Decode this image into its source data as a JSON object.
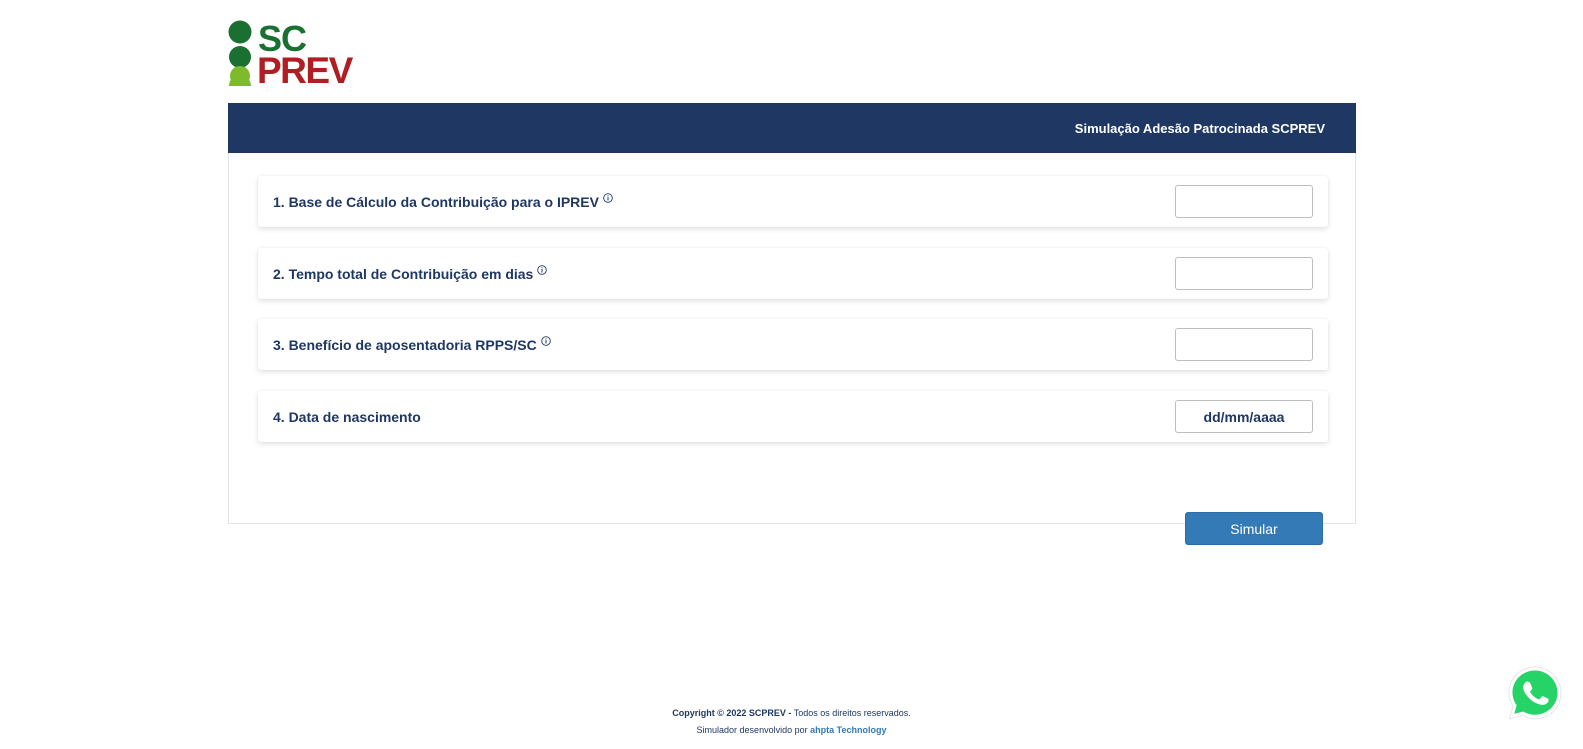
{
  "logo": {
    "text_top": "SC",
    "text_bottom": "PREV",
    "colors": {
      "green_dark": "#1a7030",
      "green_light": "#7dbb2c",
      "red": "#b01e23"
    }
  },
  "header": {
    "title": "Simulação Adesão Patrocinada SCPREV",
    "bg_color": "#1f3763"
  },
  "form": {
    "fields": [
      {
        "label": "1. Base de Cálculo da Contribuição para o IPREV",
        "info_icon": "info-icon",
        "value": "",
        "placeholder": ""
      },
      {
        "label": "2. Tempo total de Contribuição em dias",
        "info_icon": "info-icon",
        "value": "",
        "placeholder": ""
      },
      {
        "label": "3. Benefício de aposentadoria RPPS/SC",
        "info_icon": "info-icon",
        "value": "",
        "placeholder": ""
      },
      {
        "label": "4. Data de nascimento",
        "value": "",
        "placeholder": "dd/mm/aaaa"
      }
    ],
    "submit_label": "Simular",
    "submit_color": "#337ab7"
  },
  "footer": {
    "copyright": "Copyright © 2022 SCPREV -",
    "rights": " Todos os direitos reservados.",
    "developed_by": "Simulador desenvolvido por ",
    "developer": "ahpta Technology"
  },
  "floating": {
    "whatsapp_icon": "whatsapp-icon",
    "whatsapp_color": "#25d366"
  }
}
